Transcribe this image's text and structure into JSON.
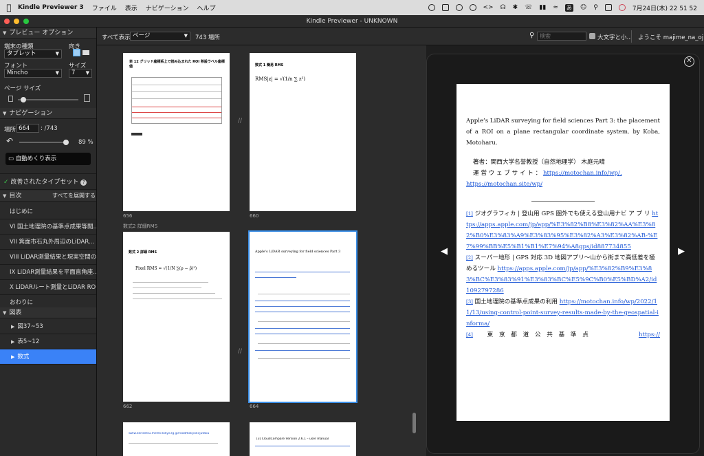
{
  "menubar": {
    "app": "Kindle Previewer 3",
    "items": [
      "ファイル",
      "表示",
      "ナビゲーション",
      "ヘルプ"
    ],
    "clock": "7月24日(木)  22 51 52",
    "input_mode": "あ"
  },
  "window": {
    "title": "Kindle Previewer - UNKNOWN"
  },
  "sidebar": {
    "preview_options": "プレビュー オプション",
    "device_type_label": "端末の種類",
    "device_value": "タブレット",
    "orientation_label": "向き",
    "font_label": "フォント",
    "font_value": "Mincho",
    "size_label": "サイズ",
    "size_value": "7",
    "page_size_label": "ページ サイズ",
    "navigation": "ナビゲーション",
    "location_label": "場所",
    "location_value": "664",
    "location_total": ": /743",
    "percent": "89 %",
    "auto_flip": "自動めくり表示",
    "improved_typesetting": "改善されたタイプセット",
    "toc_label": "目次",
    "expand_all": "すべてを展開する",
    "toc": [
      "はじめに",
      "VI 国土地理院の基準点成果等閲...",
      "VII 箕面市石丸外周辺のLiDAR...",
      "VIII LiDAR測量結果と現実空間の...",
      "IX LiDAR測量結果を平面直角座...",
      "X LiDARルート測量とLiDAR ROI...",
      "おわりに"
    ],
    "figures_label": "図表",
    "figures": [
      "図37~53",
      "表5~12",
      "数式"
    ]
  },
  "toolbar": {
    "show_all": "すべて表示",
    "view_value": "ページ",
    "location_count": "743 場所",
    "search_placeholder": "検索",
    "large_text": "大文字と小...",
    "welcome": "ようこそ majime_na_oj..."
  },
  "thumbnails": {
    "p656": "656",
    "p660": "660",
    "p662": "662",
    "p664": "664",
    "section": "数式2 詳細RMS",
    "t656_title": "表 12 グリッド座標系上で読み込まれた ROI 移設ラベル座標値",
    "t660_title": "数式 1 簡易 RMS",
    "t662_title": "数式 2 詳細 RMS",
    "t664_title": "Apple's LiDAR surveying for field sciences Part 3",
    "t_bottom1": "www.kensetsu.metro.tokyo.lg.jp/road/kokyoki/jutaku",
    "t_bottom2": "[3] CloudCompare Version 2.6.1 – user manual"
  },
  "viewer": {
    "para1": "Apple’s LiDAR surveying for field sciences Part 3: the placement of a ROI on a plane rectangular coordinate system. by Koba, Motoharu.",
    "author": "著者：関西大学名誉教授（自然地理学） 木庭元晴",
    "site_label": "運 営 ウ ェ ブ サ イ ト ：",
    "site_link1": "https://motochan.info/wp/,",
    "site_link2": "https://motochan.site/wp/",
    "fn1_num": "[1]",
    "fn1_text": "ジオグラフィカ | 登山用 GPS 圏外でも使える登山用ナビ ア プ リ",
    "fn1_link": "https://apps.apple.com/jp/app/%E3%82%B8%E3%82%AA%E3%82%B0%E3%83%A9%E3%83%95%E3%82%A3%E3%82%AB-%E7%99%BB%E5%B1%B1%E7%94%A8gps/id887734855",
    "fn2_num": "[2]",
    "fn2_text": "スーパー地形 | GPS 対応 3D 地図アプリ〜山から街まで高低差を極めるツール",
    "fn2_link": "https://apps.apple.com/jp/app/%E3%82%B9%E3%83%BC%E3%83%91%E3%83%BC%E5%9C%B0%E5%BD%A2/id1092797286",
    "fn3_num": "[3]",
    "fn3_text": "国土地理院の基準点成果の利用",
    "fn3_link": "https://motochan.info/wp/2022/11/13/using-control-point-survey-results-made-by-the-geospatial-informa/",
    "fn4_num": "[4]",
    "fn4_text": "東 京 都 道 公 共 基 準 点",
    "fn4_link": "https://"
  }
}
